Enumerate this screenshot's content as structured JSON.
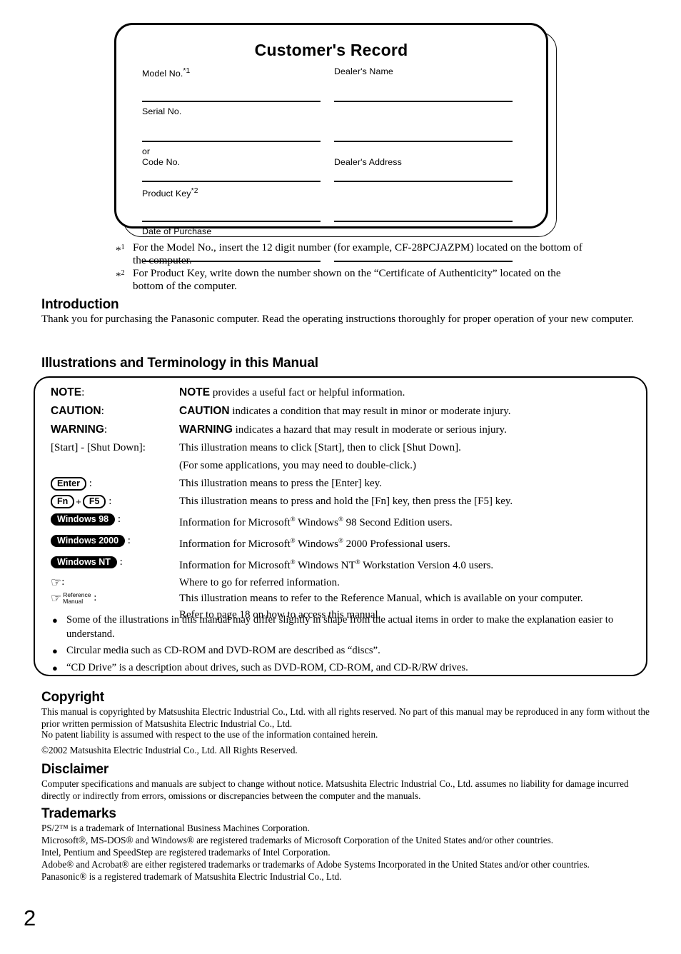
{
  "record_card": {
    "title": "Customer's Record",
    "left_fields": [
      {
        "label": "Model No.",
        "sup": "*1"
      },
      {
        "label": "Serial No.",
        "sup": ""
      },
      {
        "label": "Code No.",
        "sup": "",
        "prefix": "or"
      },
      {
        "label": "Product Key",
        "sup": "*2"
      },
      {
        "label": "Date of Purchase",
        "sup": ""
      }
    ],
    "right_fields": [
      {
        "label": "Dealer's Name",
        "sup": ""
      },
      {
        "label": "",
        "sup": ""
      },
      {
        "label": "Dealer's Address",
        "sup": ""
      },
      {
        "label": "",
        "sup": ""
      },
      {
        "label": "",
        "sup": ""
      }
    ]
  },
  "footnotes": [
    {
      "mark": "*1",
      "text": "For the Model No., insert the 12 digit number (for example, CF-28PCJAZPM) located on the bottom of the computer."
    },
    {
      "mark": "*2",
      "text": "For Product Key, write down the number shown on the “Certificate of Authenticity” located on the bottom of the computer."
    }
  ],
  "introduction": {
    "heading": "Introduction",
    "body": "Thank you for purchasing the Panasonic computer.  Read the operating instructions thoroughly for proper operation of your new computer."
  },
  "illustrations": {
    "heading": "Illustrations and Terminology in this Manual",
    "rows": [
      {
        "kind": "text",
        "term": "NOTE",
        "term_style": "sans-bold",
        "desc_lead": "NOTE",
        "desc": " provides a useful fact or helpful information."
      },
      {
        "kind": "text",
        "term": "CAUTION",
        "term_style": "sans-bold",
        "desc_lead": "CAUTION",
        "desc": " indicates a condition that may result in minor or moderate injury."
      },
      {
        "kind": "text",
        "term": "WARNING",
        "term_style": "sans-bold",
        "desc_lead": "WARNING",
        "desc": " indicates a hazard that may result in moderate or serious injury."
      },
      {
        "kind": "text",
        "term": "[Start] - [Shut Down]",
        "term_style": "serif",
        "desc_lead": "",
        "desc": "This illustration means to click [Start], then to click [Shut Down]."
      },
      {
        "kind": "continuation",
        "term": "",
        "term_style": "serif",
        "desc_lead": "",
        "desc": "(For some applications, you may need to double-click.)"
      },
      {
        "kind": "key",
        "keys": [
          "Enter"
        ],
        "desc": "This illustration means to press the [Enter] key."
      },
      {
        "kind": "key-combo",
        "keys": [
          "Fn",
          "F5"
        ],
        "combiner": "+",
        "desc": "This illustration means to press and hold the [Fn] key,  then press the [F5] key."
      },
      {
        "kind": "badge",
        "badge": "Windows 98",
        "desc_parts": [
          "Information for Microsoft",
          "®",
          " Windows",
          "®",
          " 98 Second Edition users."
        ]
      },
      {
        "kind": "badge",
        "badge": "Windows 2000",
        "desc_parts": [
          "Information for Microsoft",
          "®",
          " Windows",
          "®",
          " 2000 Professional users."
        ]
      },
      {
        "kind": "badge",
        "badge": "Windows NT",
        "desc_parts": [
          "Information for Microsoft",
          "®",
          " Windows NT",
          "®",
          " Workstation Version 4.0 users."
        ]
      },
      {
        "kind": "hand",
        "icon": "pointing-hand-icon",
        "sub_label": "",
        "desc": "Where to go for referred information."
      },
      {
        "kind": "hand",
        "icon": "pointing-hand-icon",
        "sub_label_line1": "Reference",
        "sub_label_line2": "Manual",
        "desc": "This illustration means to refer to the Reference Manual, which is available on your computer."
      },
      {
        "kind": "continuation",
        "term": "",
        "term_style": "serif",
        "desc_lead": "",
        "desc": "Refer to page 18 on how to access this manual."
      }
    ],
    "bullets": [
      "Some of the illustrations in this manual may differ slightly in shape from the actual items in order to make the explanation easier to understand.",
      "Circular media such as CD-ROM and DVD-ROM are described as “discs”.",
      "“CD Drive” is a description about drives, such as DVD-ROM, CD-ROM, and CD-R/RW drives."
    ]
  },
  "copyright": {
    "heading": "Copyright",
    "para1": "This manual is copyrighted by Matsushita Electric Industrial Co., Ltd. with all rights reserved.  No part of this manual may be reproduced in any form without the prior written permission of Matsushita Electric Industrial Co., Ltd.",
    "para2": "No patent liability is assumed with respect to the use of the information contained herein.",
    "para3": "©2002 Matsushita Electric Industrial Co., Ltd.  All Rights Reserved."
  },
  "disclaimer": {
    "heading": "Disclaimer",
    "body": "Computer specifications and manuals are subject to change without notice.  Matsushita Electric Industrial Co., Ltd. assumes no liability for damage incurred directly or indirectly from errors, omissions or discrepancies between the computer and the manuals."
  },
  "trademarks": {
    "heading": "Trademarks",
    "lines": [
      "PS/2™ is a trademark of International Business Machines Corporation.",
      "Microsoft®, MS-DOS® and Windows® are registered trademarks of Microsoft Corporation of the United States and/or other countries.",
      "Intel, Pentium and SpeedStep are registered trademarks of Intel Corporation.",
      "Adobe® and Acrobat® are either registered trademarks or trademarks of Adobe Systems Incorporated in the United States and/or other countries.",
      "Panasonic® is a registered trademark of Matsushita Electric Industrial Co., Ltd."
    ]
  },
  "page_number": "2"
}
